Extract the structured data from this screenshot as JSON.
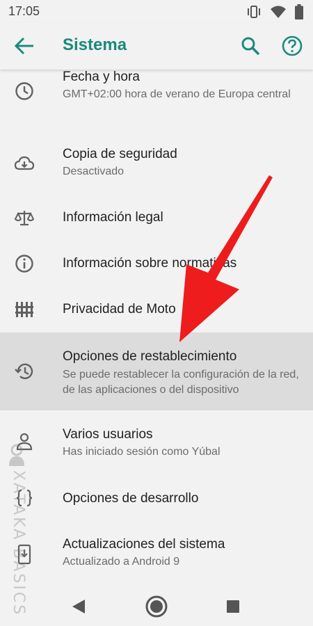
{
  "status_bar": {
    "time": "17:05",
    "icons": [
      "vibrate-icon",
      "wifi-icon",
      "battery-icon"
    ]
  },
  "app_bar": {
    "title": "Sistema",
    "accent_color": "#1b8a7d",
    "icons": [
      "back-arrow-icon",
      "search-icon",
      "help-icon"
    ]
  },
  "items": [
    {
      "label": "Fecha y hora",
      "subtitle": "GMT+02:00 hora de verano de Europa central",
      "icon": "clock-icon"
    },
    {
      "label": "Copia de seguridad",
      "subtitle": "Desactivado",
      "icon": "cloud-backup-icon"
    },
    {
      "label": "Información legal",
      "subtitle": "",
      "icon": "scale-icon"
    },
    {
      "label": "Información sobre normativas",
      "subtitle": "",
      "icon": "info-icon"
    },
    {
      "label": "Privacidad de Moto",
      "subtitle": "",
      "icon": "fence-icon"
    },
    {
      "label": "Opciones de restablecimiento",
      "subtitle": "Se puede restablecer la configuración de la red, de las aplicaciones o del dispositivo",
      "icon": "history-icon",
      "highlighted": true
    },
    {
      "label": "Varios usuarios",
      "subtitle": "Has iniciado sesión como Yúbal",
      "icon": "person-icon"
    },
    {
      "label": "Opciones de desarrollo",
      "subtitle": "",
      "icon": "code-braces-icon"
    },
    {
      "label": "Actualizaciones del sistema",
      "subtitle": "Actualizado a Android 9",
      "icon": "system-update-icon"
    }
  ],
  "nav_bar": {
    "buttons": [
      "back-triangle-icon",
      "home-circle-icon",
      "recents-square-icon"
    ]
  },
  "annotation": {
    "type": "red-arrow",
    "color": "#ee1c1c"
  },
  "watermark": {
    "text": "XATAKA BASICS"
  }
}
